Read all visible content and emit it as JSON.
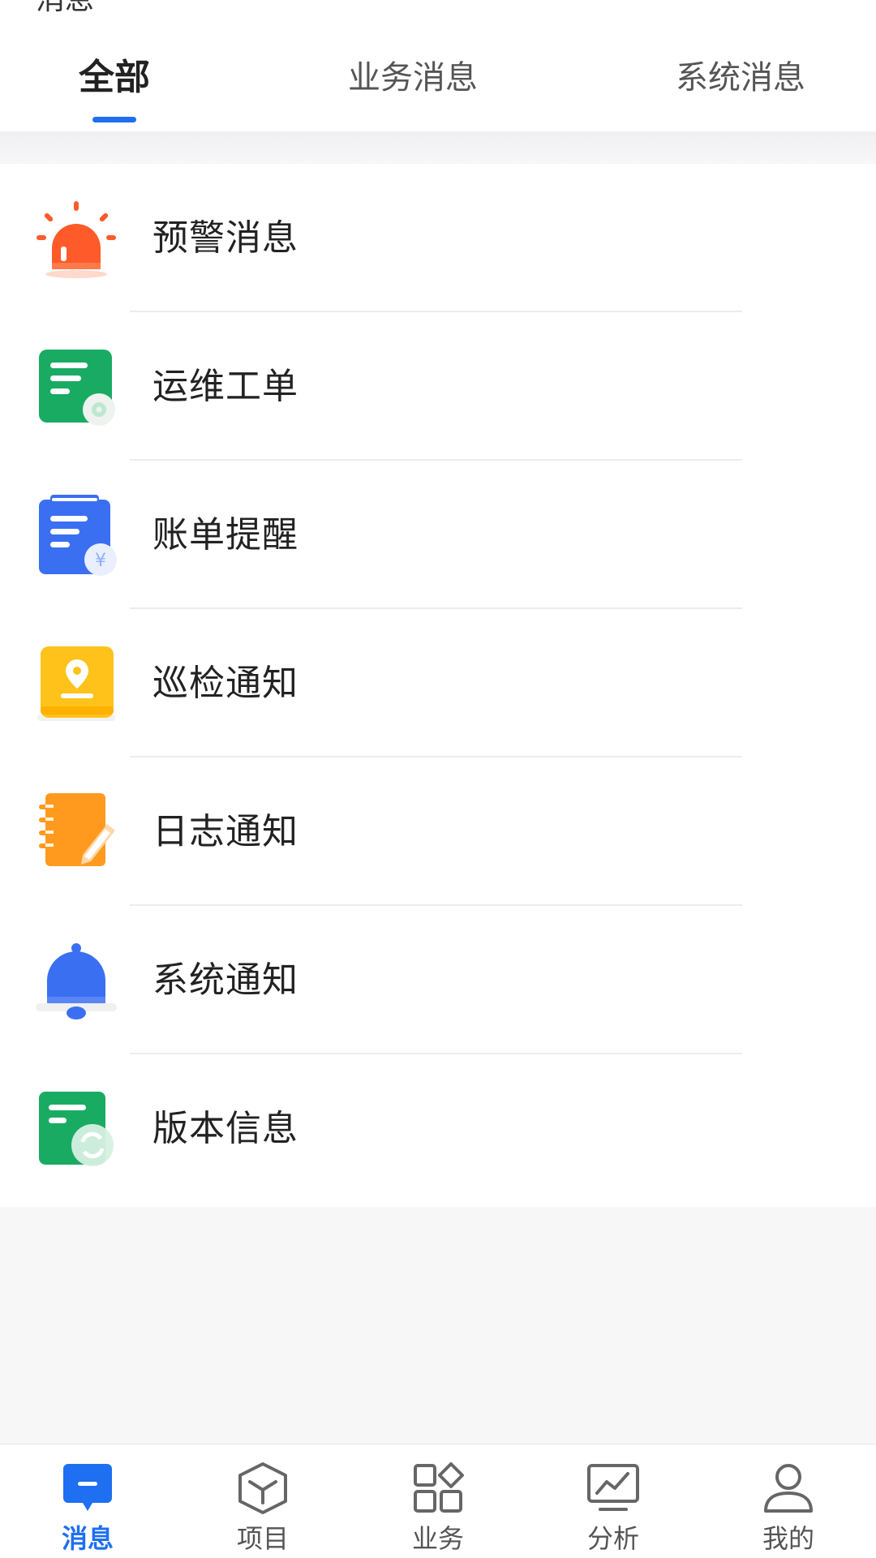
{
  "header": {
    "title": "消息",
    "tabs": [
      {
        "label": "全部",
        "active": true
      },
      {
        "label": "业务消息",
        "active": false
      },
      {
        "label": "系统消息",
        "active": false
      }
    ]
  },
  "list": {
    "items": [
      {
        "label": "预警消息",
        "icon": "alarm-light-icon"
      },
      {
        "label": "运维工单",
        "icon": "work-order-gear-icon"
      },
      {
        "label": "账单提醒",
        "icon": "bill-yen-icon"
      },
      {
        "label": "巡检通知",
        "icon": "inspection-location-icon"
      },
      {
        "label": "日志通知",
        "icon": "log-notebook-pen-icon"
      },
      {
        "label": "系统通知",
        "icon": "bell-icon"
      },
      {
        "label": "版本信息",
        "icon": "version-refresh-icon"
      }
    ]
  },
  "tabbar": {
    "items": [
      {
        "label": "消息",
        "icon": "message-icon",
        "active": true
      },
      {
        "label": "项目",
        "icon": "cube-icon",
        "active": false
      },
      {
        "label": "业务",
        "icon": "apps-grid-icon",
        "active": false
      },
      {
        "label": "分析",
        "icon": "chart-monitor-icon",
        "active": false
      },
      {
        "label": "我的",
        "icon": "user-icon",
        "active": false
      }
    ]
  },
  "colors": {
    "accent": "#1e6ff1",
    "alarm": "#ff5a2a",
    "green": "#1aab63",
    "blue": "#3b6ff2",
    "yellow": "#ffc21a",
    "orange": "#ff9a1f"
  }
}
